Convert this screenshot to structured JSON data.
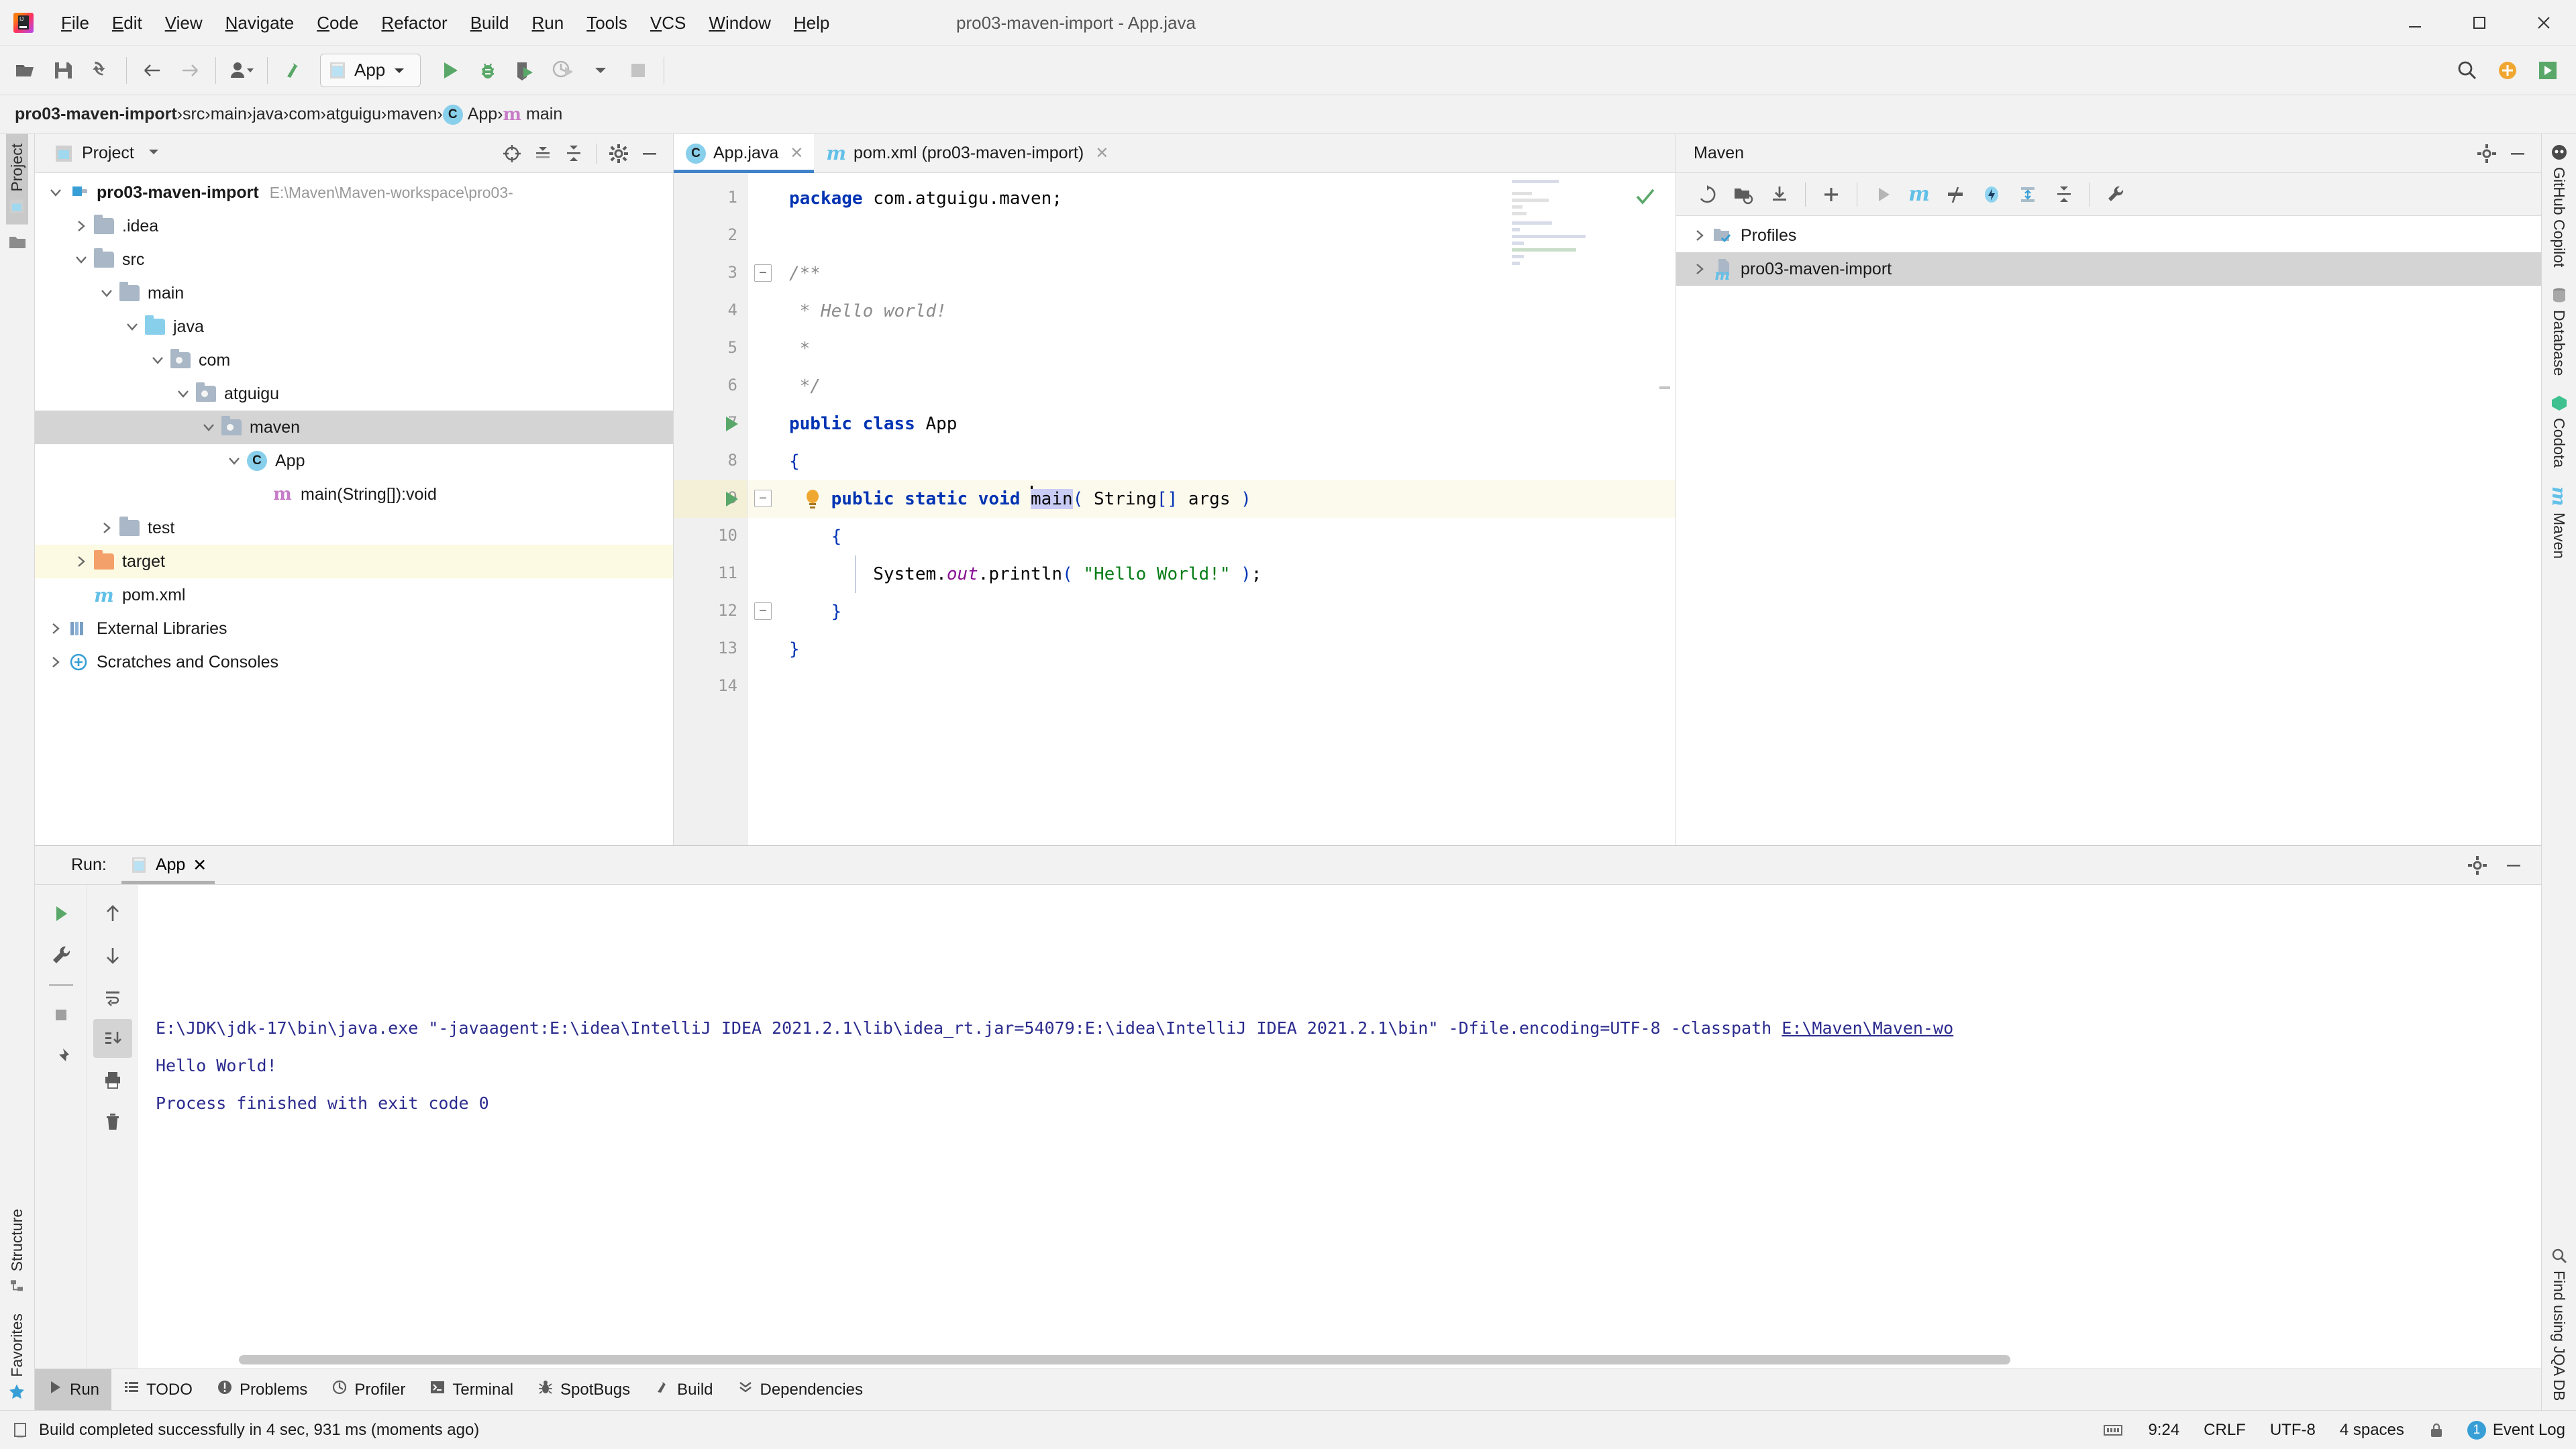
{
  "window": {
    "title": "pro03-maven-import - App.java",
    "menu": [
      "File",
      "Edit",
      "View",
      "Navigate",
      "Code",
      "Refactor",
      "Build",
      "Run",
      "Tools",
      "VCS",
      "Window",
      "Help"
    ],
    "controls": [
      "minimize",
      "maximize",
      "close"
    ]
  },
  "toolbar": {
    "run_config": "App",
    "icons": [
      "open-folder-icon",
      "save-icon",
      "sync-icon",
      "back-arrow-icon",
      "forward-arrow-icon",
      "vcs-user-icon",
      "update-project-icon"
    ],
    "right_icons": [
      "run-icon",
      "debug-icon",
      "run-coverage-icon",
      "profiler-icon",
      "dropdown-icon",
      "stop-icon",
      "search-icon",
      "plus-icon",
      "ide-icon"
    ]
  },
  "breadcrumb": [
    {
      "label": "pro03-maven-import",
      "bold": true,
      "icon": ""
    },
    {
      "label": "src",
      "bold": false,
      "icon": ""
    },
    {
      "label": "main",
      "bold": false,
      "icon": ""
    },
    {
      "label": "java",
      "bold": false,
      "icon": ""
    },
    {
      "label": "com",
      "bold": false,
      "icon": ""
    },
    {
      "label": "atguigu",
      "bold": false,
      "icon": ""
    },
    {
      "label": "maven",
      "bold": false,
      "icon": ""
    },
    {
      "label": "App",
      "bold": false,
      "icon": "class-icon"
    },
    {
      "label": "main",
      "bold": false,
      "icon": "method-icon"
    }
  ],
  "left_rail": [
    {
      "label": "Project",
      "active": true,
      "icon": "project-icon"
    },
    {
      "label": "",
      "active": false,
      "icon": "structure-icon"
    }
  ],
  "left_rail_bottom": [
    {
      "label": "Structure",
      "icon": "structure-icon"
    },
    {
      "label": "Favorites",
      "icon": "star-icon"
    }
  ],
  "right_rail": [
    {
      "label": "GitHub Copilot",
      "icon": "copilot-icon"
    },
    {
      "label": "Database",
      "icon": "database-icon"
    },
    {
      "label": "Codota",
      "icon": "codota-icon"
    },
    {
      "label": "Maven",
      "icon": "maven-icon"
    }
  ],
  "right_rail_bottom": [
    {
      "label": "Find using JQA DB",
      "icon": "jqa-icon"
    }
  ],
  "project_panel": {
    "title": "Project",
    "head_icons": [
      "locate-icon",
      "expand-all-icon",
      "collapse-all-icon",
      "gear-icon",
      "hide-icon"
    ],
    "tree": [
      {
        "depth": 0,
        "label": "pro03-maven-import",
        "path": "E:\\Maven\\Maven-workspace\\pro03-",
        "twist": "down",
        "icon": "module-folder-icon",
        "bold": true,
        "state": "normal"
      },
      {
        "depth": 1,
        "label": ".idea",
        "path": "",
        "twist": "right",
        "icon": "folder-icon",
        "bold": false,
        "state": "normal"
      },
      {
        "depth": 1,
        "label": "src",
        "path": "",
        "twist": "down",
        "icon": "folder-icon",
        "bold": false,
        "state": "normal"
      },
      {
        "depth": 2,
        "label": "main",
        "path": "",
        "twist": "down",
        "icon": "folder-icon",
        "bold": false,
        "state": "normal"
      },
      {
        "depth": 3,
        "label": "java",
        "path": "",
        "twist": "down",
        "icon": "source-folder-icon",
        "bold": false,
        "state": "normal"
      },
      {
        "depth": 4,
        "label": "com",
        "path": "",
        "twist": "down",
        "icon": "package-icon",
        "bold": false,
        "state": "normal"
      },
      {
        "depth": 5,
        "label": "atguigu",
        "path": "",
        "twist": "down",
        "icon": "package-icon",
        "bold": false,
        "state": "normal"
      },
      {
        "depth": 6,
        "label": "maven",
        "path": "",
        "twist": "down",
        "icon": "package-icon",
        "bold": false,
        "state": "selected"
      },
      {
        "depth": 7,
        "label": "App",
        "path": "",
        "twist": "down",
        "icon": "java-class-icon",
        "bold": false,
        "state": "normal"
      },
      {
        "depth": 8,
        "label": "main(String[]):void",
        "path": "",
        "twist": "none",
        "icon": "method-icon",
        "bold": false,
        "state": "normal"
      },
      {
        "depth": 2,
        "label": "test",
        "path": "",
        "twist": "right",
        "icon": "folder-icon",
        "bold": false,
        "state": "normal"
      },
      {
        "depth": 1,
        "label": "target",
        "path": "",
        "twist": "right",
        "icon": "excluded-folder-icon",
        "bold": false,
        "state": "highlight"
      },
      {
        "depth": 1,
        "label": "pom.xml",
        "path": "",
        "twist": "none",
        "icon": "maven-file-icon",
        "bold": false,
        "state": "normal"
      },
      {
        "depth": 0,
        "label": "External Libraries",
        "path": "",
        "twist": "right",
        "icon": "libraries-icon",
        "bold": false,
        "state": "normal"
      },
      {
        "depth": 0,
        "label": "Scratches and Consoles",
        "path": "",
        "twist": "right",
        "icon": "scratches-icon",
        "bold": false,
        "state": "normal"
      }
    ]
  },
  "editor": {
    "tabs": [
      {
        "label": "App.java",
        "icon": "java-class-icon",
        "active": true,
        "closable": true
      },
      {
        "label": "pom.xml (pro03-maven-import)",
        "icon": "maven-file-icon",
        "active": false,
        "closable": true
      }
    ],
    "inspection_status": "ok-check",
    "line_numbers": [
      "1",
      "2",
      "3",
      "4",
      "5",
      "6",
      "7",
      "8",
      "9",
      "10",
      "11",
      "12",
      "13",
      "14"
    ],
    "code": [
      {
        "n": 1,
        "text": "package com.atguigu.maven;"
      },
      {
        "n": 2,
        "text": ""
      },
      {
        "n": 3,
        "text": "/**"
      },
      {
        "n": 4,
        "text": " * Hello world!"
      },
      {
        "n": 5,
        "text": " *"
      },
      {
        "n": 6,
        "text": " */"
      },
      {
        "n": 7,
        "text": "public class App"
      },
      {
        "n": 8,
        "text": "{"
      },
      {
        "n": 9,
        "text": "    public static void main( String[] args )"
      },
      {
        "n": 10,
        "text": "    {"
      },
      {
        "n": 11,
        "text": "        System.out.println( \"Hello World!\" );"
      },
      {
        "n": 12,
        "text": "    }"
      },
      {
        "n": 13,
        "text": "}"
      },
      {
        "n": 14,
        "text": ""
      }
    ],
    "caret_line": 9,
    "selected_token": "main"
  },
  "maven_panel": {
    "title": "Maven",
    "toolbar_icons": [
      "reimport-icon",
      "generate-sources-icon",
      "download-sources-icon",
      "add-maven-project-icon",
      "run-icon",
      "execute-maven-goal-icon",
      "toggle-skip-tests-icon",
      "toggle-offline-icon",
      "expand-all-icon",
      "collapse-all-icon",
      "settings-wrench-icon"
    ],
    "head_icons": [
      "gear-icon",
      "hide-icon"
    ],
    "tree": [
      {
        "label": "Profiles",
        "twist": "right",
        "icon": "profiles-icon",
        "state": "normal"
      },
      {
        "label": "pro03-maven-import",
        "twist": "right",
        "icon": "maven-project-icon",
        "state": "selected"
      }
    ]
  },
  "run_panel": {
    "label": "Run:",
    "tab": "App",
    "head_icons": [
      "gear-icon",
      "hide-icon"
    ],
    "left_icons": [
      "rerun-icon",
      "settings-wrench-icon",
      "stop-icon",
      "pin-icon"
    ],
    "right_icons": [
      "up-arrow-icon",
      "down-arrow-icon",
      "soft-wrap-icon",
      "scroll-to-end-icon",
      "print-icon",
      "trash-icon"
    ],
    "console_lines": [
      {
        "text": "E:\\JDK\\jdk-17\\bin\\java.exe \"-javaagent:E:\\idea\\IntelliJ IDEA 2021.2.1\\lib\\idea_rt.jar=54079:E:\\idea\\IntelliJ IDEA 2021.2.1\\bin\" -Dfile.encoding=UTF-8 -classpath ",
        "link": "E:\\Maven\\Maven-wo",
        "type": "cmd"
      },
      {
        "text": "Hello World!",
        "link": "",
        "type": "out"
      },
      {
        "text": "",
        "link": "",
        "type": "out"
      },
      {
        "text": "Process finished with exit code 0",
        "link": "",
        "type": "out"
      }
    ]
  },
  "toolwindow_bar": [
    {
      "label": "Run",
      "icon": "run-icon",
      "active": true
    },
    {
      "label": "TODO",
      "icon": "todo-icon",
      "active": false
    },
    {
      "label": "Problems",
      "icon": "problems-icon",
      "active": false
    },
    {
      "label": "Profiler",
      "icon": "profiler-icon",
      "active": false
    },
    {
      "label": "Terminal",
      "icon": "terminal-icon",
      "active": false
    },
    {
      "label": "SpotBugs",
      "icon": "spotbugs-icon",
      "active": false
    },
    {
      "label": "Build",
      "icon": "build-icon",
      "active": false
    },
    {
      "label": "Dependencies",
      "icon": "dependencies-icon",
      "active": false
    }
  ],
  "status_bar": {
    "message": "Build completed successfully in 4 sec, 931 ms (moments ago)",
    "event_log": "Event Log",
    "event_count": "1",
    "position": "9:24",
    "line_sep": "CRLF",
    "encoding": "UTF-8",
    "indent": "4 spaces",
    "icons": [
      "memory-icon",
      "bug-icon",
      "lock-icon"
    ]
  }
}
